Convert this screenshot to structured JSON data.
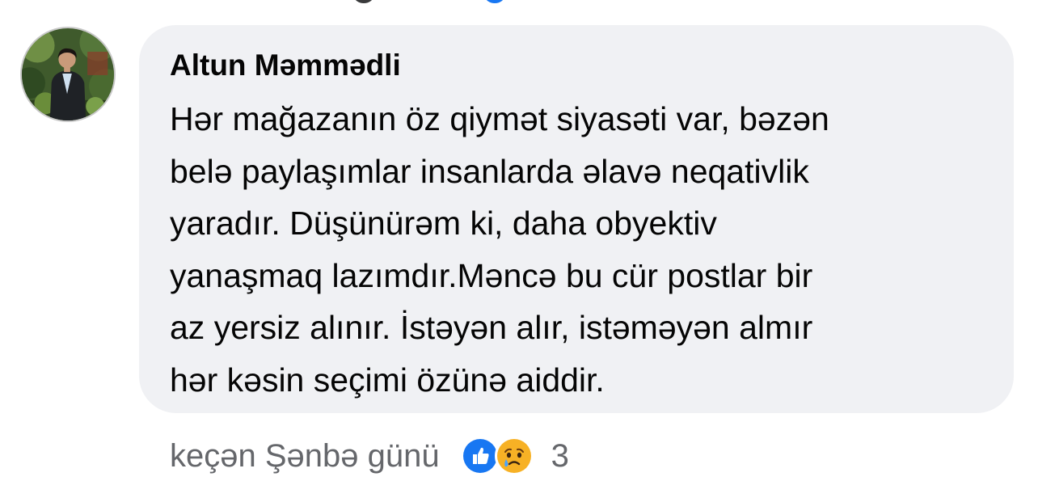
{
  "comment": {
    "author": "Altun Məmmədli",
    "lines": [
      "Hər mağazanın öz qiymət siyasəti var, bəzən",
      "belə paylaşımlar insanlarda əlavə neqativlik",
      "yaradır. Düşünürəm ki, daha obyektiv",
      "yanaşmaq lazımdır.Məncə bu cür postlar bir",
      "az yersiz alınır. İstəyən alır, istəməyən almır",
      "hər kəsin seçimi özünə aiddir."
    ],
    "timestamp": "keçən Şənbə günü",
    "reactions": {
      "icons": [
        "like-icon",
        "sad-icon"
      ],
      "count": "3"
    }
  },
  "colors": {
    "bubble_bg": "#f0f1f4",
    "text": "#050505",
    "meta_text": "#65676b",
    "like_blue": "#1877f2",
    "sad_yellow": "#f7b125"
  }
}
